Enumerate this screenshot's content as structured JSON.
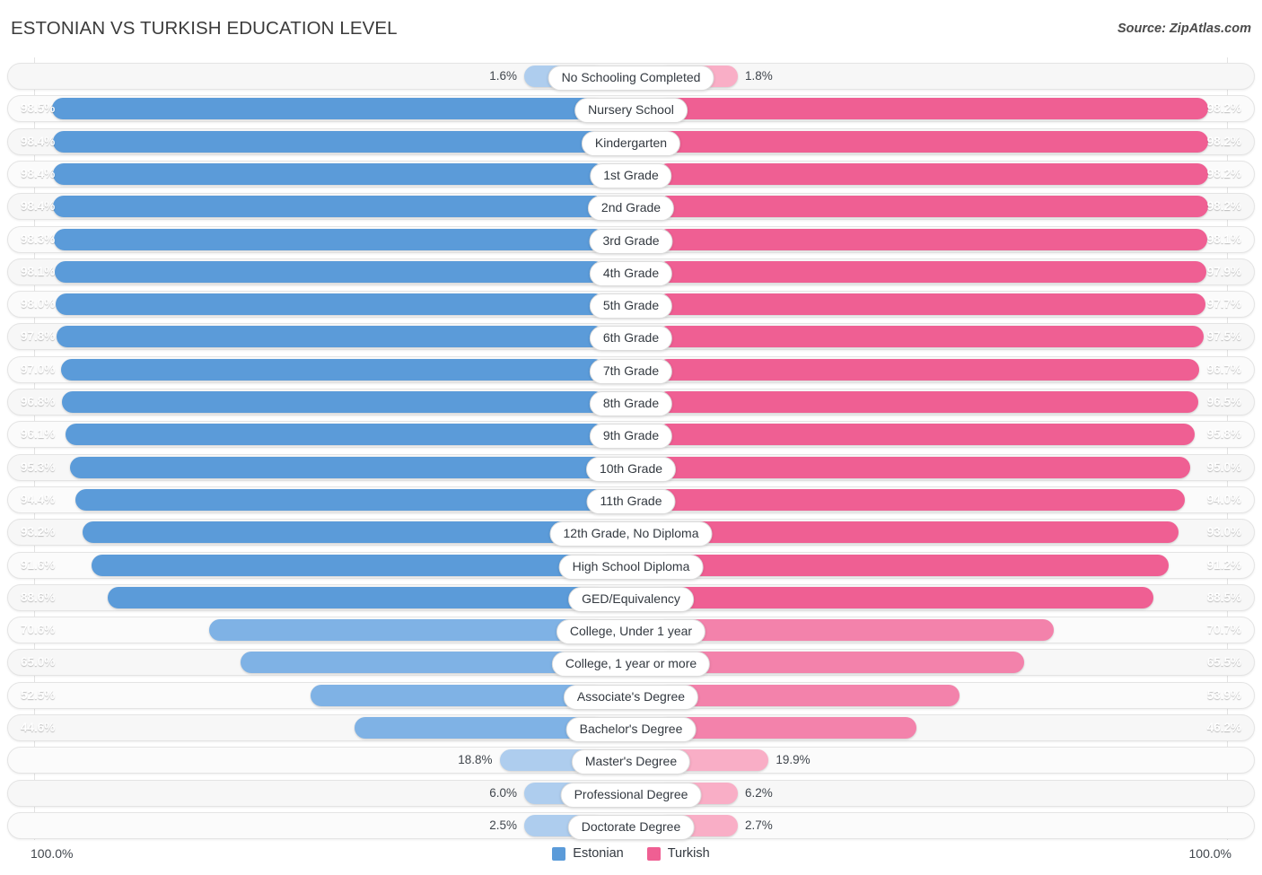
{
  "header": {
    "title": "ESTONIAN VS TURKISH EDUCATION LEVEL",
    "source": "Source: ZipAtlas.com"
  },
  "legend": {
    "items": [
      {
        "label": "Estonian",
        "color": "#5b9bd9"
      },
      {
        "label": "Turkish",
        "color": "#ef5f93"
      }
    ]
  },
  "axis": {
    "left_max": "100.0%",
    "right_max": "100.0%"
  },
  "colors": {
    "blue_strong": "#5b9bd9",
    "blue_mid": "#7fb2e5",
    "blue_light": "#aecdee",
    "pink_strong": "#ef5f93",
    "pink_mid": "#f382ab",
    "pink_light": "#f9aec6",
    "track": "#f7f7f7",
    "track_border": "#e4e4e4"
  },
  "chart_data": {
    "type": "bar",
    "title": "ESTONIAN VS TURKISH EDUCATION LEVEL",
    "subtitle": "",
    "xlabel": "",
    "ylabel": "",
    "orientation": "horizontal-diverging",
    "xlim": [
      0,
      100
    ],
    "grid": false,
    "legend_position": "bottom-center",
    "categories": [
      "No Schooling Completed",
      "Nursery School",
      "Kindergarten",
      "1st Grade",
      "2nd Grade",
      "3rd Grade",
      "4th Grade",
      "5th Grade",
      "6th Grade",
      "7th Grade",
      "8th Grade",
      "9th Grade",
      "10th Grade",
      "11th Grade",
      "12th Grade, No Diploma",
      "High School Diploma",
      "GED/Equivalency",
      "College, Under 1 year",
      "College, 1 year or more",
      "Associate's Degree",
      "Bachelor's Degree",
      "Master's Degree",
      "Professional Degree",
      "Doctorate Degree"
    ],
    "series": [
      {
        "name": "Estonian",
        "color": "#5b9bd9",
        "values": [
          1.6,
          98.5,
          98.4,
          98.4,
          98.4,
          98.3,
          98.1,
          98.0,
          97.8,
          97.0,
          96.8,
          96.1,
          95.3,
          94.4,
          93.2,
          91.6,
          88.6,
          70.6,
          65.0,
          52.5,
          44.6,
          18.8,
          6.0,
          2.5
        ],
        "labels": [
          "1.6%",
          "98.5%",
          "98.4%",
          "98.4%",
          "98.4%",
          "98.3%",
          "98.1%",
          "98.0%",
          "97.8%",
          "97.0%",
          "96.8%",
          "96.1%",
          "95.3%",
          "94.4%",
          "93.2%",
          "91.6%",
          "88.6%",
          "70.6%",
          "65.0%",
          "52.5%",
          "44.6%",
          "18.8%",
          "6.0%",
          "2.5%"
        ]
      },
      {
        "name": "Turkish",
        "color": "#ef5f93",
        "values": [
          1.8,
          98.2,
          98.2,
          98.2,
          98.2,
          98.1,
          97.9,
          97.7,
          97.5,
          96.7,
          96.5,
          95.8,
          95.0,
          94.0,
          93.0,
          91.2,
          88.5,
          70.7,
          65.5,
          53.9,
          46.2,
          19.9,
          6.2,
          2.7
        ],
        "labels": [
          "1.8%",
          "98.2%",
          "98.2%",
          "98.2%",
          "98.2%",
          "98.1%",
          "97.9%",
          "97.7%",
          "97.5%",
          "96.7%",
          "96.5%",
          "95.8%",
          "95.0%",
          "94.0%",
          "93.0%",
          "91.2%",
          "88.5%",
          "70.7%",
          "65.5%",
          "53.9%",
          "46.2%",
          "19.9%",
          "6.2%",
          "2.7%"
        ]
      }
    ]
  }
}
